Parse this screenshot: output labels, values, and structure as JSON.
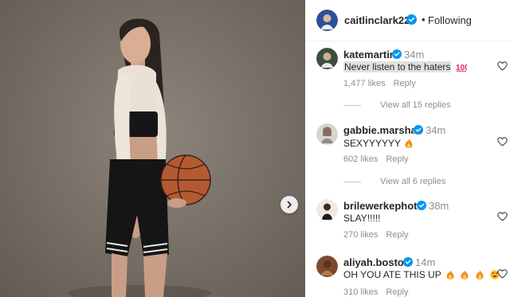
{
  "post": {
    "author": "caitlinclark22",
    "follow_label": "Following",
    "dot": "•"
  },
  "comments": [
    {
      "user": "katemartin",
      "time": "34m",
      "text": "Never listen to the haters",
      "emoji": "100",
      "likes": "1,477 likes",
      "reply": "Reply",
      "view_replies": "View all 15 replies"
    },
    {
      "user": "gabbie.marshall",
      "time": "34m",
      "text": "SEXYYYYYY",
      "emoji": "fire",
      "likes": "602 likes",
      "reply": "Reply",
      "view_replies": "View all 6 replies"
    },
    {
      "user": "brilewerkephoto",
      "time": "38m",
      "text": "SLAY!!!!!",
      "likes": "270 likes",
      "reply": "Reply"
    },
    {
      "user": "aliyah.boston",
      "time": "14m",
      "text": "OH YOU ATE THIS UP",
      "emoji": "fire fire fire heart-eyes",
      "likes": "310 likes",
      "reply": "Reply"
    }
  ],
  "icons": {
    "verified": "verified-badge-icon",
    "heart": "heart-outline-icon",
    "next": "chevron-right-icon"
  },
  "colors": {
    "verified_blue": "#0095f6",
    "muted_text": "#8e8e8e",
    "fire": "#f6891f"
  }
}
